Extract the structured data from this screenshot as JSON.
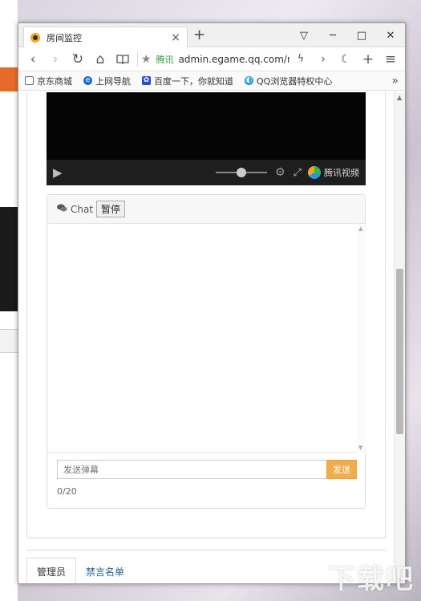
{
  "browser": {
    "tab_title": "房间监控",
    "tab_close": "×",
    "new_tab": "+",
    "window_controls": {
      "minimize": "─",
      "maximize": "□",
      "close": "✕",
      "ui": "▽"
    },
    "address": {
      "verified_label": "腾讯",
      "url": "admin.egame.qq.com/room"
    },
    "nav": {
      "back": "‹",
      "forward": "›",
      "reload": "↻",
      "home": "⌂",
      "reader": "📖",
      "star": "★",
      "more_menu": "≡",
      "plus": "+"
    },
    "bookmarks": [
      {
        "label": "京东商城",
        "icon_color": "#666"
      },
      {
        "label": "上网导航",
        "icon_color": "#1d70d0"
      },
      {
        "label": "百度一下，你就知道",
        "icon_color": "#2a4ad4"
      },
      {
        "label": "QQ浏览器特权中心",
        "icon_color": "#1d9be0"
      }
    ],
    "bookmarks_more": "»"
  },
  "player": {
    "play_icon": "▶",
    "gear_icon": "⚙",
    "fullscreen_icon": "⤢",
    "brand_text": "腾讯视频"
  },
  "chat": {
    "header_label": "Chat",
    "pause_button": "暂停",
    "input_placeholder": "发送弹幕",
    "send_button": "发送",
    "counter": "0/20"
  },
  "tabs": [
    {
      "label": "管理员",
      "active": true
    },
    {
      "label": "禁言名单",
      "active": false
    }
  ],
  "watermark": "下载吧"
}
